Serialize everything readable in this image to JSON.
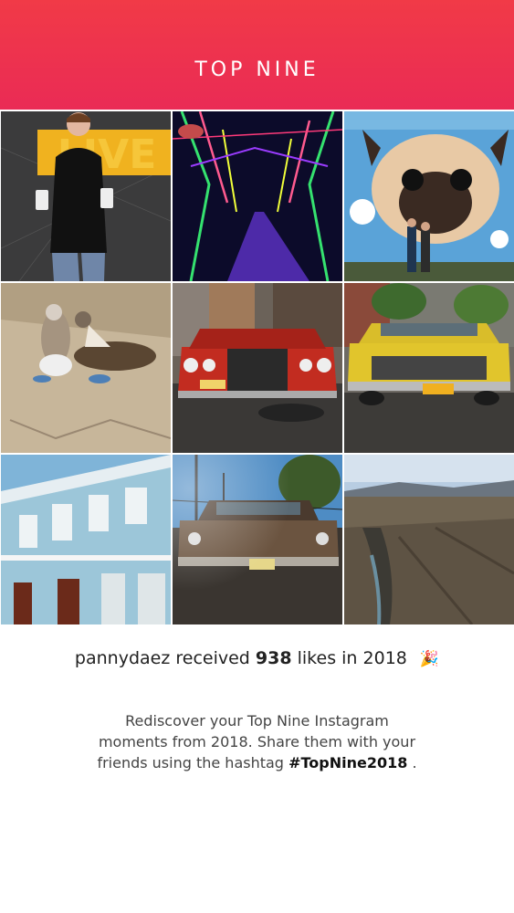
{
  "header": {
    "title": "TOP NINE",
    "gradient_top": "#f13a47",
    "gradient_bottom": "#ea2b55"
  },
  "photos": [
    {
      "label": "Man in black turtleneck holding two iPods in front of a yellow LIVE sign",
      "sign_text": "LIVE"
    },
    {
      "label": "Neon lit tunnel of glowing branches"
    },
    {
      "label": "Couple posing in front of a giant pug mural"
    },
    {
      "label": "Blue-footed booby birds on sandy ground"
    },
    {
      "label": "Red vintage car on a city street",
      "plate": "GMG340"
    },
    {
      "label": "Yellow vintage convertible on a street",
      "plate": "HDZ4465"
    },
    {
      "label": "Light blue colonial building with balconies"
    },
    {
      "label": "Brown vintage car in sunlight",
      "plate": "58426"
    },
    {
      "label": "Deep canyon with river under blue sky"
    }
  ],
  "summary": {
    "username": "pannydaez",
    "text_received": "received",
    "likes": "938",
    "text_likes_in": "likes in",
    "year": "2018",
    "emoji": "🎉"
  },
  "description": {
    "line1": "Rediscover your Top Nine Instagram",
    "line2": "moments from 2018. Share them with your",
    "line3_prefix": "friends using the hashtag",
    "hashtag": "#TopNine2018",
    "line3_suffix": "."
  }
}
